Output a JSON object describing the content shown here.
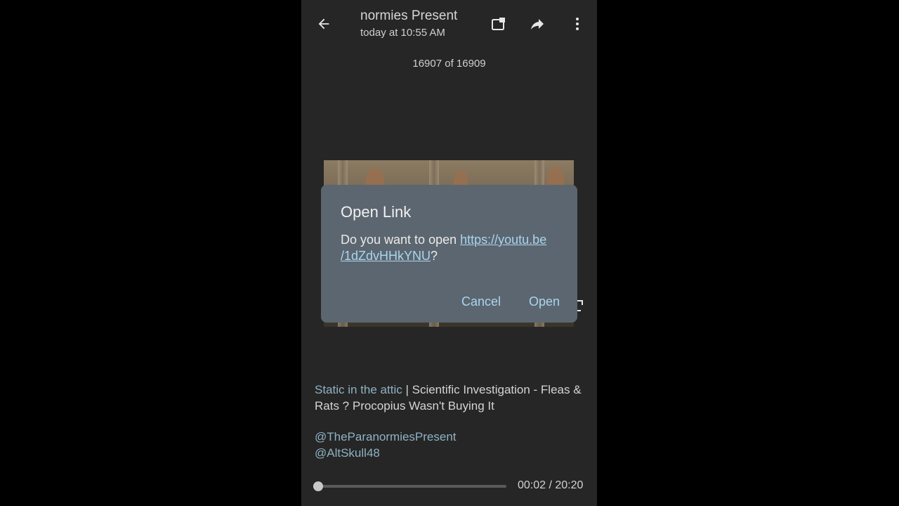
{
  "header": {
    "title": "normies Present",
    "subtitle": "today at 10:55 AM",
    "back_icon": "arrow-left-icon",
    "icons": [
      "open-in-chat-icon",
      "share-forward-icon",
      "more-vertical-icon"
    ]
  },
  "counter": "16907 of 16909",
  "caption": {
    "link1": "Static in the attic",
    "separator": " | ",
    "text1": "Scientific Investigation - Fleas & Rats ? Procopius Wasn't Buying It",
    "mention1": "@TheParanormiesPresent",
    "mention2": "@AltSkull48"
  },
  "player": {
    "time": "00:02 / 20:20",
    "progress_fraction": 0.0016
  },
  "dialog": {
    "title": "Open Link",
    "message_prefix": "Do you want to open ",
    "url_line1": "https://youtu.be",
    "url_line2": "/1dZdvHHkYNU",
    "message_suffix": "?",
    "cancel_label": "Cancel",
    "open_label": "Open"
  },
  "colors": {
    "background": "#262626",
    "dialog_bg": "#5c6670",
    "accent_link": "#a9d6ee",
    "caption_link": "#8fb2c4"
  }
}
